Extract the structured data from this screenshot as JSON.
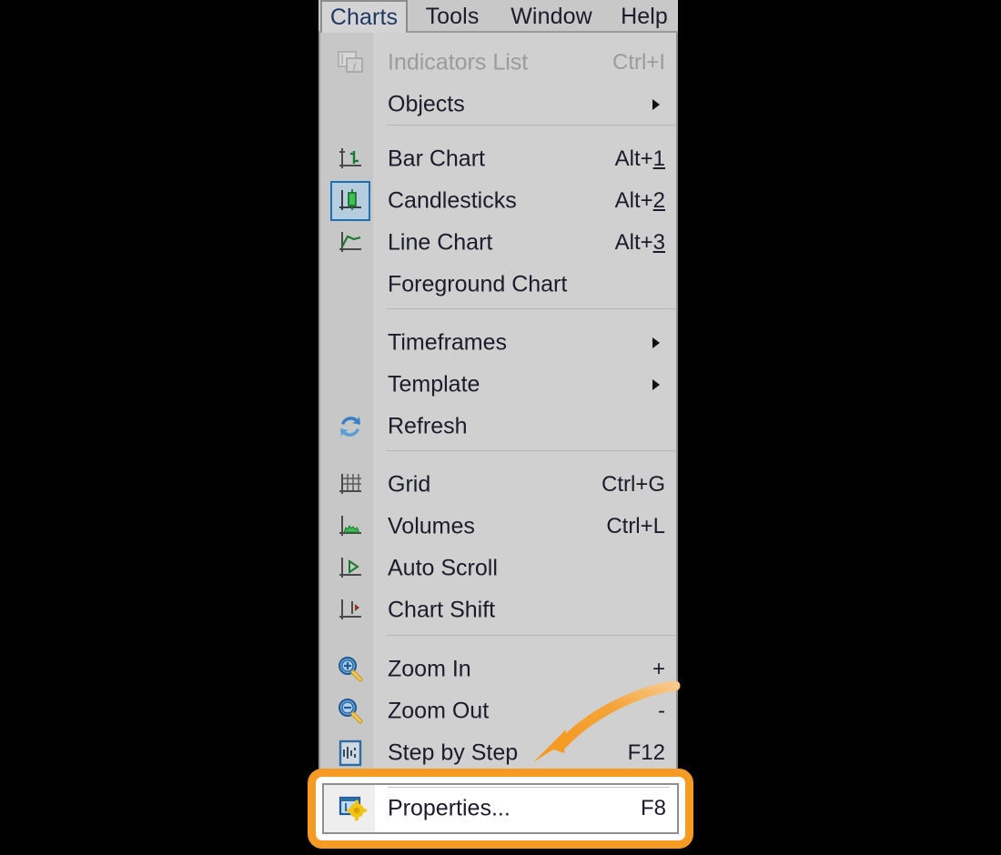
{
  "app": {
    "menubar": [
      {
        "id": "charts",
        "label": "Charts",
        "active": true
      },
      {
        "id": "tools",
        "label": "Tools",
        "active": false
      },
      {
        "id": "window",
        "label": "Window",
        "active": false
      },
      {
        "id": "help",
        "label": "Help",
        "active": false
      }
    ]
  },
  "menu": {
    "title": "Charts",
    "items": [
      {
        "label": "Indicators List",
        "accel": "Ctrl+I",
        "icon": "indicators-list-icon",
        "disabled": true,
        "submenu": false
      },
      {
        "label": "Objects",
        "accel": "",
        "icon": "none",
        "disabled": false,
        "submenu": true
      },
      {
        "label": "Bar Chart",
        "accel": "Alt+1",
        "accel_underline": "1",
        "icon": "bar-chart-icon",
        "disabled": false,
        "submenu": false
      },
      {
        "label": "Candlesticks",
        "accel": "Alt+2",
        "accel_underline": "2",
        "icon": "candlesticks-icon",
        "disabled": false,
        "submenu": false,
        "selected": true
      },
      {
        "label": "Line Chart",
        "accel": "Alt+3",
        "accel_underline": "3",
        "icon": "line-chart-icon",
        "disabled": false,
        "submenu": false
      },
      {
        "label": "Foreground Chart",
        "accel": "",
        "icon": "none",
        "disabled": false,
        "submenu": false
      },
      {
        "label": "Timeframes",
        "accel": "",
        "icon": "none",
        "disabled": false,
        "submenu": true
      },
      {
        "label": "Template",
        "accel": "",
        "icon": "none",
        "disabled": false,
        "submenu": true
      },
      {
        "label": "Refresh",
        "accel": "",
        "icon": "refresh-icon",
        "disabled": false,
        "submenu": false
      },
      {
        "label": "Grid",
        "accel": "Ctrl+G",
        "icon": "grid-icon",
        "disabled": false,
        "submenu": false
      },
      {
        "label": "Volumes",
        "accel": "Ctrl+L",
        "icon": "volumes-icon",
        "disabled": false,
        "submenu": false
      },
      {
        "label": "Auto Scroll",
        "accel": "",
        "icon": "auto-scroll-icon",
        "disabled": false,
        "submenu": false
      },
      {
        "label": "Chart Shift",
        "accel": "",
        "icon": "chart-shift-icon",
        "disabled": false,
        "submenu": false
      },
      {
        "label": "Zoom In",
        "accel": "+",
        "icon": "zoom-in-icon",
        "disabled": false,
        "submenu": false
      },
      {
        "label": "Zoom Out",
        "accel": "-",
        "icon": "zoom-out-icon",
        "disabled": false,
        "submenu": false
      },
      {
        "label": "Step by Step",
        "accel": "F12",
        "icon": "step-by-step-icon",
        "disabled": false,
        "submenu": false
      }
    ],
    "highlighted_item": {
      "label": "Properties...",
      "accel": "F8",
      "icon": "properties-gear-icon"
    }
  },
  "annotation": {
    "type": "curved-arrow",
    "color": "#f59a23",
    "points_to": "Properties...",
    "highlight_color": "#f59a23"
  },
  "colors": {
    "menu_bg": "#d0d0d0",
    "gutter_bg": "#c7c7c7",
    "menubar_bg": "#c8c8c8",
    "text": "#1b1b2b",
    "disabled_text": "#9b9b9b",
    "accent_orange": "#f59a23",
    "selection_blue": "#1a6fb5",
    "backdrop": "#000000"
  }
}
